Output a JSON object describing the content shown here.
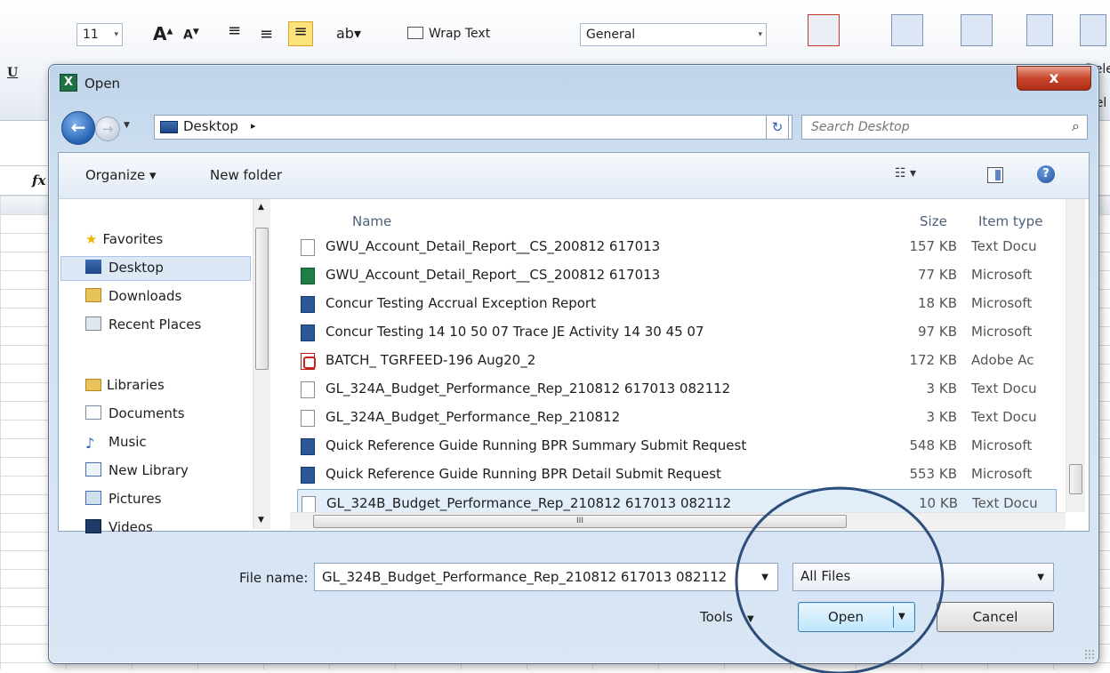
{
  "excel": {
    "font_size": "11",
    "wrap_text": "Wrap Text",
    "number_format": "General",
    "underline_label": "U",
    "fx_label": "fx",
    "cells_partial": "Dele",
    "cells_label": "Cel"
  },
  "dialog": {
    "title": "Open",
    "close_label": "x",
    "address": {
      "location": "Desktop",
      "separator": "▸"
    },
    "search_placeholder": "Search Desktop",
    "toolbar": {
      "organize": "Organize ▾",
      "new_folder": "New folder",
      "help": "?"
    },
    "nav": {
      "favorites_header": "Favorites",
      "favorites": [
        "Desktop",
        "Downloads",
        "Recent Places"
      ],
      "libraries_header": "Libraries",
      "libraries": [
        "Documents",
        "Music",
        "New Library",
        "Pictures",
        "Videos"
      ]
    },
    "columns": {
      "name": "Name",
      "size": "Size",
      "type": "Item type"
    },
    "files": [
      {
        "name": "GWU_Account_Detail_Report__CS_200812 617013",
        "size": "157 KB",
        "type": "Text Docu",
        "icon": "text"
      },
      {
        "name": "GWU_Account_Detail_Report__CS_200812 617013",
        "size": "77 KB",
        "type": "Microsoft",
        "icon": "excel"
      },
      {
        "name": "Concur Testing  Accrual Exception Report",
        "size": "18 KB",
        "type": "Microsoft",
        "icon": "word"
      },
      {
        "name": "Concur Testing 14 10 50 07 Trace JE Activity  14 30 45 07",
        "size": "97 KB",
        "type": "Microsoft",
        "icon": "word"
      },
      {
        "name": "BATCH_ TGRFEED-196 Aug20_2",
        "size": "172 KB",
        "type": "Adobe Ac",
        "icon": "pdf"
      },
      {
        "name": "GL_324A_Budget_Performance_Rep_210812 617013 082112",
        "size": "3 KB",
        "type": "Text Docu",
        "icon": "text"
      },
      {
        "name": "GL_324A_Budget_Performance_Rep_210812",
        "size": "3 KB",
        "type": "Text Docu",
        "icon": "text"
      },
      {
        "name": "Quick Reference Guide Running BPR Summary Submit Request",
        "size": "548 KB",
        "type": "Microsoft",
        "icon": "word"
      },
      {
        "name": "Quick Reference Guide Running BPR Detail Submit Request",
        "size": "553 KB",
        "type": "Microsoft",
        "icon": "word"
      },
      {
        "name": "GL_324B_Budget_Performance_Rep_210812 617013 082112",
        "size": "10 KB",
        "type": "Text Docu",
        "icon": "text",
        "selected": true
      }
    ],
    "hscroll_grip": "III",
    "file_name_label": "File name:",
    "file_name_value": "GL_324B_Budget_Performance_Rep_210812 617013 082112",
    "filter_value": "All Files",
    "tools_label": "Tools",
    "open_label": "Open",
    "cancel_label": "Cancel"
  },
  "colors": {
    "annotation_circle": "#2e4d7a",
    "selection": "#e3eefb",
    "dialog_frame": "#cfe0f1"
  }
}
